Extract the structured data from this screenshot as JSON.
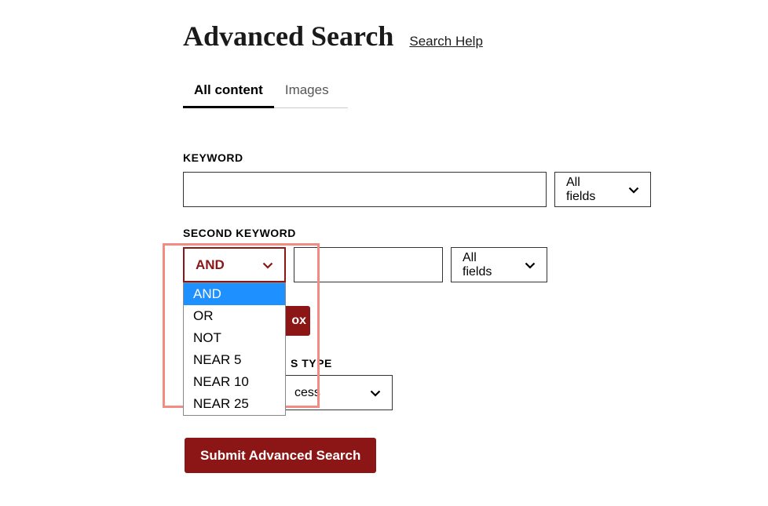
{
  "title": "Advanced Search",
  "help_link": "Search Help",
  "tabs": {
    "all_content": "All content",
    "images": "Images"
  },
  "keyword": {
    "label": "KEYWORD",
    "value": "",
    "fields_label": "All fields"
  },
  "second_keyword": {
    "label": "SECOND KEYWORD",
    "operator_selected": "AND",
    "operators": [
      "AND",
      "OR",
      "NOT",
      "NEAR 5",
      "NEAR 10",
      "NEAR 25"
    ],
    "value": "",
    "fields_label": "All fields"
  },
  "add_box_label": "ox",
  "access": {
    "label_partial": "S TYPE",
    "value_partial": "cess"
  },
  "submit_label": "Submit Advanced Search"
}
